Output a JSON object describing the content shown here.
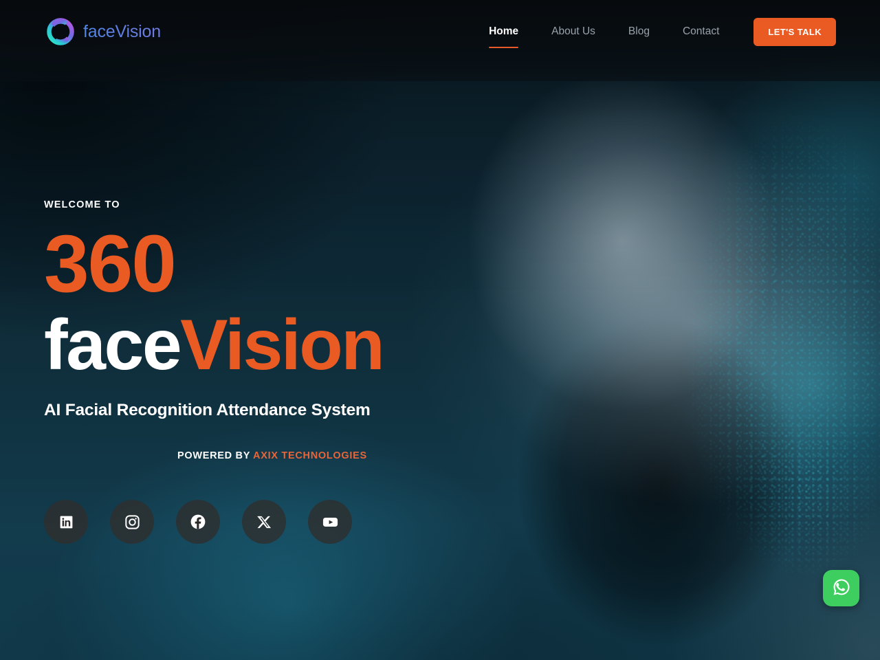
{
  "site": {
    "brand_name": "faceVision",
    "logo_icon": "facevision-ring-logo-icon"
  },
  "header": {
    "nav_items": [
      {
        "label": "Home",
        "active": true
      },
      {
        "label": "About Us",
        "active": false
      },
      {
        "label": "Blog",
        "active": false
      },
      {
        "label": "Contact",
        "active": false
      }
    ],
    "cta_label": "LET'S TALK"
  },
  "hero": {
    "eyebrow": "WELCOME TO",
    "title_number": "360",
    "title_light": "face",
    "title_accent": "Vision",
    "subtitle": "AI Facial Recognition Attendance System",
    "powered_prefix": "POWERED BY",
    "powered_company": "AXIX TECHNOLOGIES"
  },
  "socials": [
    {
      "name": "LinkedIn",
      "icon": "linkedin-icon"
    },
    {
      "name": "Instagram",
      "icon": "instagram-icon"
    },
    {
      "name": "Facebook",
      "icon": "facebook-icon"
    },
    {
      "name": "X",
      "icon": "x-twitter-icon"
    },
    {
      "name": "YouTube",
      "icon": "youtube-icon"
    }
  ],
  "floating_action": {
    "label": "WhatsApp",
    "icon": "whatsapp-icon"
  },
  "colors": {
    "accent_orange": "#ea5b23",
    "brand_blue": "#5b82e4",
    "whatsapp_green": "#3ece5f",
    "text_light": "#ffffff",
    "nav_inactive": "#9aa3ab",
    "bg_dark": "#0a1a22"
  }
}
